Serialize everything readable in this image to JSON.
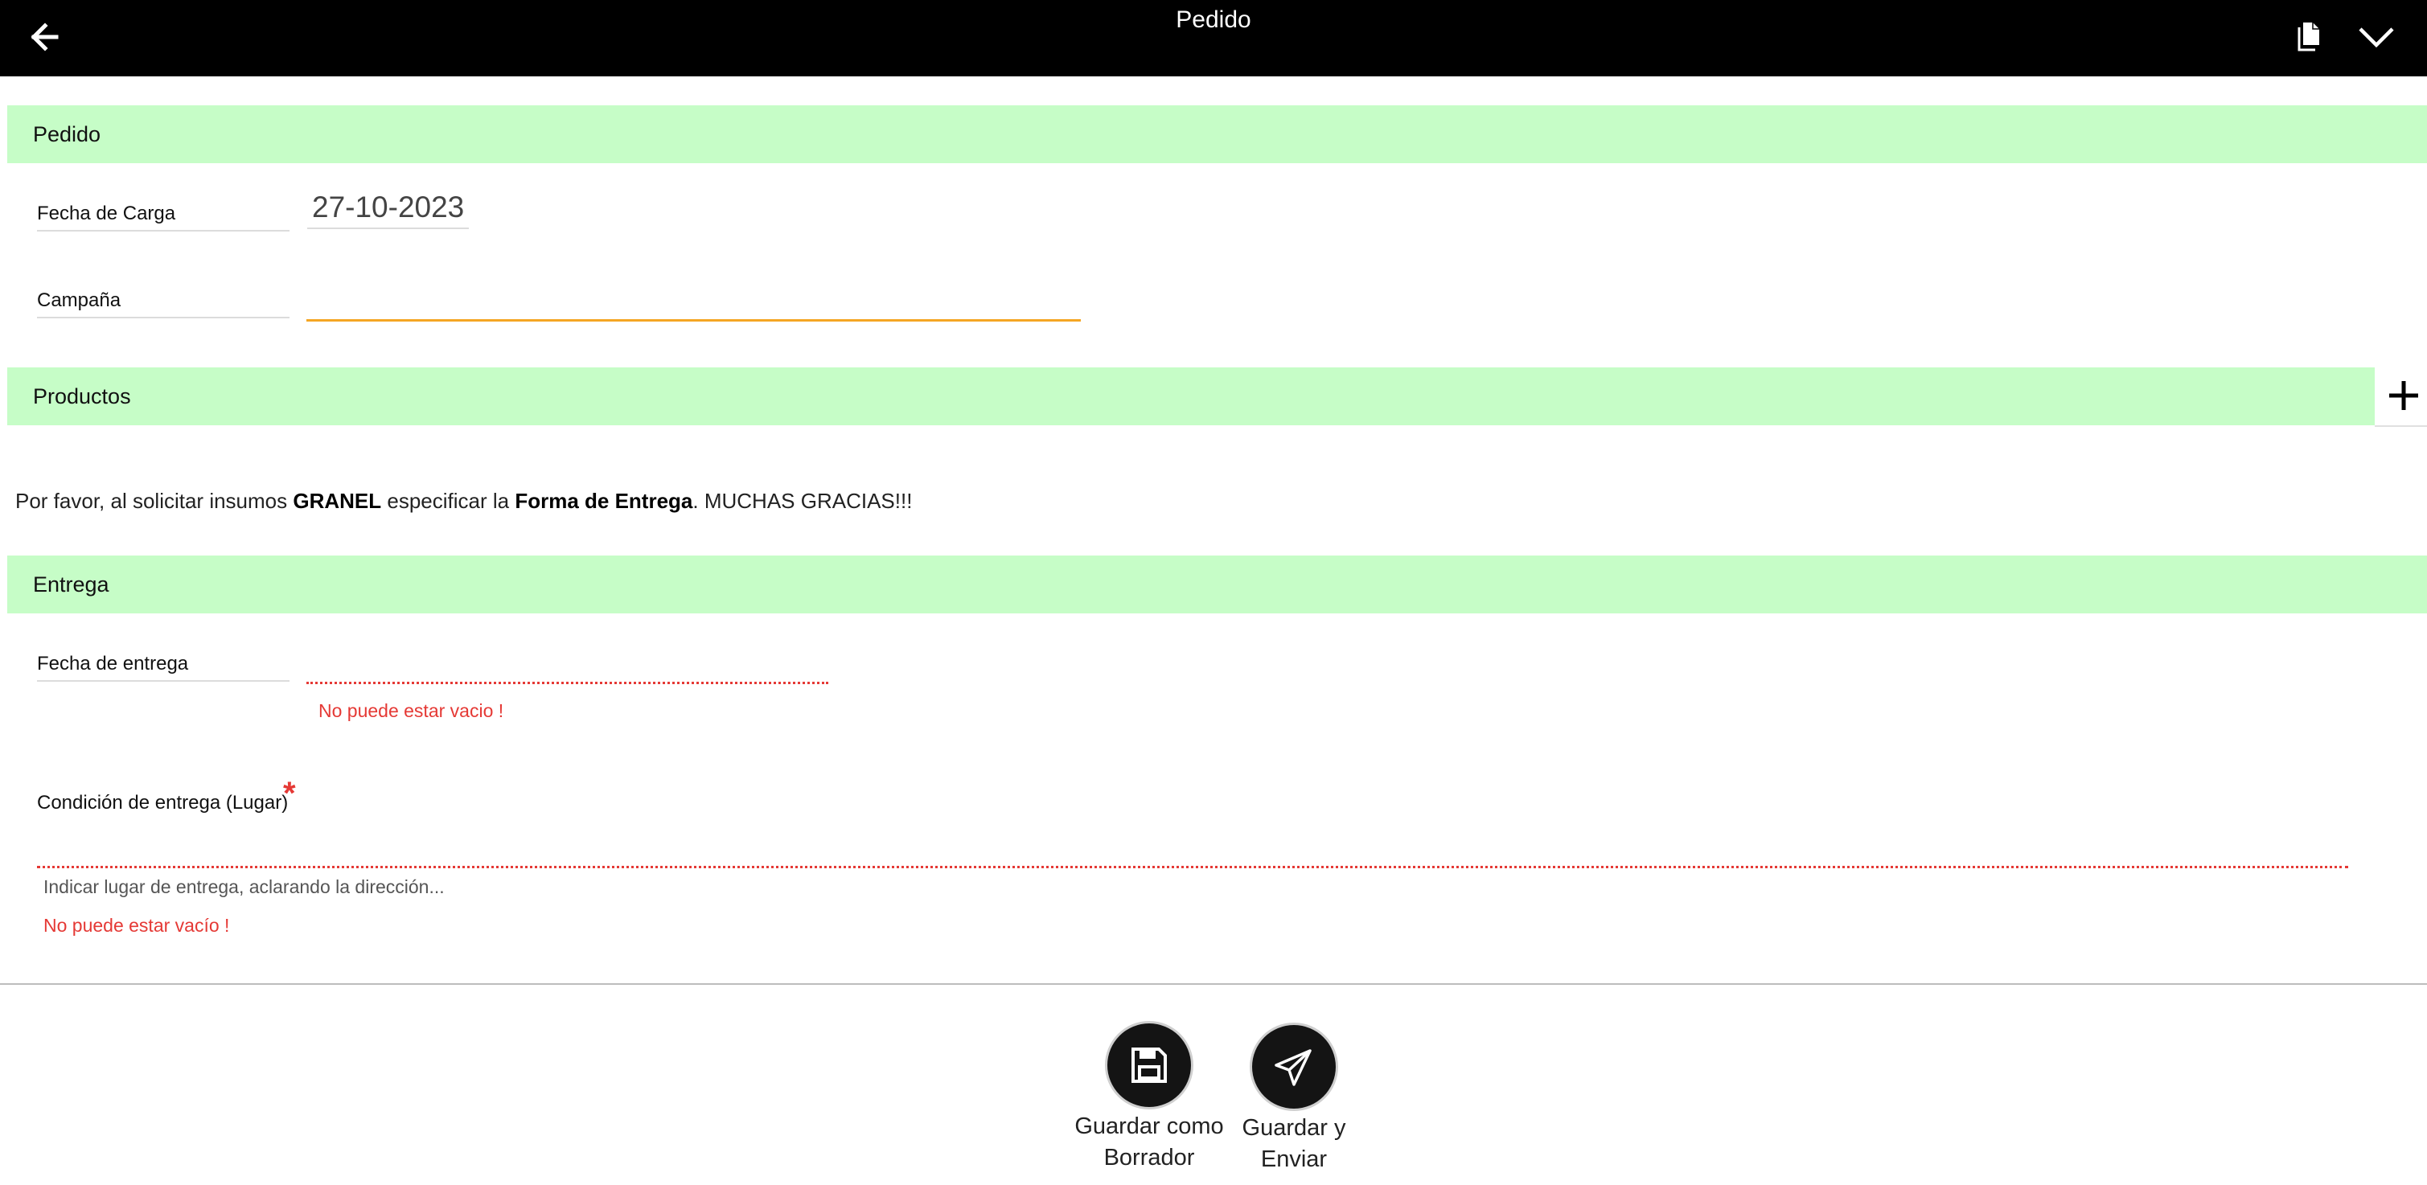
{
  "header": {
    "title": "Pedido",
    "back_icon": "arrow-left-icon",
    "document_icon": "document-icon",
    "menu_icon": "chevron-down-icon"
  },
  "sections": {
    "pedido": "Pedido",
    "productos": "Productos",
    "entrega": "Entrega"
  },
  "pedido": {
    "fecha_carga_label": "Fecha de Carga",
    "fecha_carga_value": "27-10-2023",
    "campana_label": "Campaña",
    "campana_value": ""
  },
  "productos": {
    "add_icon": "plus-icon",
    "notice": {
      "part1": "Por favor, al solicitar insumos ",
      "bold1": "GRANEL",
      "part2": " especificar la ",
      "bold2": "Forma de Entrega",
      "part3": ". MUCHAS GRACIAS!!!"
    }
  },
  "entrega": {
    "fecha_entrega_label": "Fecha de entrega",
    "fecha_entrega_value": "",
    "fecha_entrega_error": "No puede estar vacio !",
    "condicion_label": "Condición de entrega (Lugar)",
    "required_mark": "*",
    "condicion_value": "",
    "condicion_placeholder": "Indicar lugar de entrega, aclarando la dirección...",
    "condicion_error": "No puede estar vacío !"
  },
  "actions": {
    "save_draft_line1": "Guardar como",
    "save_draft_line2": "Borrador",
    "save_send_line1": "Guardar y",
    "save_send_line2": "Enviar"
  },
  "colors": {
    "top_bar": "#000000",
    "section_header_bg": "#c6fdc7",
    "focus_accent": "#f5a623",
    "error": "#e53935"
  }
}
